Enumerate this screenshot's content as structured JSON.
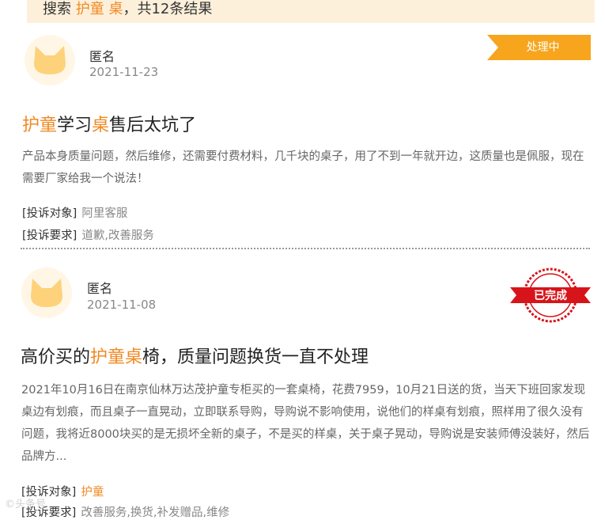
{
  "search": {
    "prefix": "搜索",
    "keyword": "护童 桌",
    "suffix": "，共12条结果"
  },
  "complaints": [
    {
      "author": "匿名",
      "date": "2021-11-23",
      "status": "处理中",
      "title_parts": [
        "护童",
        "学习",
        "桌",
        "售后太坑了"
      ],
      "description": "产品本身质量问题，然后维修，还需要付费材料，几千块的桌子，用了不到一年就开边，这质量也是佩服，现在需要厂家给我一个说法！",
      "target_label": "[投诉对象]",
      "target_value": "阿里客服",
      "request_label": "[投诉要求]",
      "request_value": "道歉,改善服务"
    },
    {
      "author": "匿名",
      "date": "2021-11-08",
      "status": "已完成",
      "title_parts": [
        "高价买的",
        "护童桌",
        "椅，质量问题换货一直不处理"
      ],
      "description": "2021年10月16日在南京仙林万达茂护童专柜买的一套桌椅，花费7959，10月21日送的货，当天下班回家发现桌边有划痕，而且桌子一直晃动，立即联系导购，导购说不影响使用，说他们的样桌有划痕，照样用了很久没有问题，我将近8000块买的是无损坏全新的桌子，不是买的样桌，关于桌子晃动，导购说是安装师傅没装好，然后品牌方...",
      "target_label": "[投诉对象]",
      "target_value": "护童",
      "request_label": "[投诉要求]",
      "request_value": "改善服务,换货,补发赠品,维修"
    }
  ],
  "watermark": "©头条号",
  "colors": {
    "accent": "#f08a24",
    "ribbon": "#f7a51c",
    "stamp": "#d7141a",
    "search_bg": "#fdf0db"
  },
  "icons": [
    "cat-avatar-icon",
    "status-ribbon",
    "completed-stamp-icon"
  ]
}
